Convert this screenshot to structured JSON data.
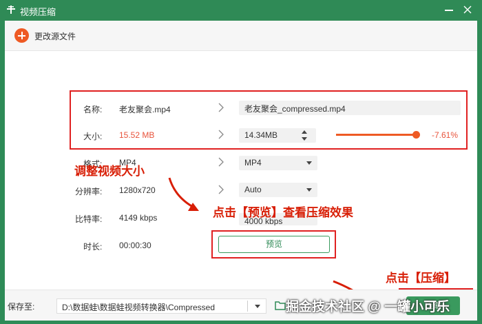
{
  "window": {
    "title": "视频压缩"
  },
  "toolbar": {
    "change_source_label": "更改源文件"
  },
  "form": {
    "name": {
      "label": "名称:",
      "source": "老友聚会.mp4",
      "output": "老友聚会_compressed.mp4"
    },
    "size": {
      "label": "大小:",
      "source": "15.52 MB",
      "output": "14.34MB",
      "percent": "-7.61%"
    },
    "format": {
      "label": "格式:",
      "source": "MP4",
      "output": "MP4"
    },
    "resolution": {
      "label": "分辨率:",
      "source": "1280x720",
      "output": "Auto"
    },
    "bitrate": {
      "label": "比特率:",
      "source": "4149 kbps",
      "output": "4000 kbps"
    },
    "duration": {
      "label": "时长:",
      "source": "00:00:30"
    },
    "preview_button": "预览"
  },
  "footer": {
    "save_to_label": "保存至:",
    "save_path": "D:\\数据蛙\\数据蛙视频转换器\\Compressed",
    "compress_button": "压缩"
  },
  "annotations": {
    "adjust_size": "调整视频大小",
    "click_preview": "点击【预览】查看压缩效果",
    "click_compress": "点击【压缩】"
  },
  "watermark": "掘金技术社区 @ 一罐小可乐",
  "colors": {
    "title_bar": "#2f8a56",
    "accent_orange": "#ee5a24",
    "annotation_red": "#d81e06",
    "button_green": "#3a9a5e"
  },
  "icons": [
    "app-icon",
    "minimize-icon",
    "close-icon",
    "add-icon",
    "chevron-right-icon",
    "dropdown-arrow-icon",
    "spinner-icon",
    "folder-icon"
  ]
}
